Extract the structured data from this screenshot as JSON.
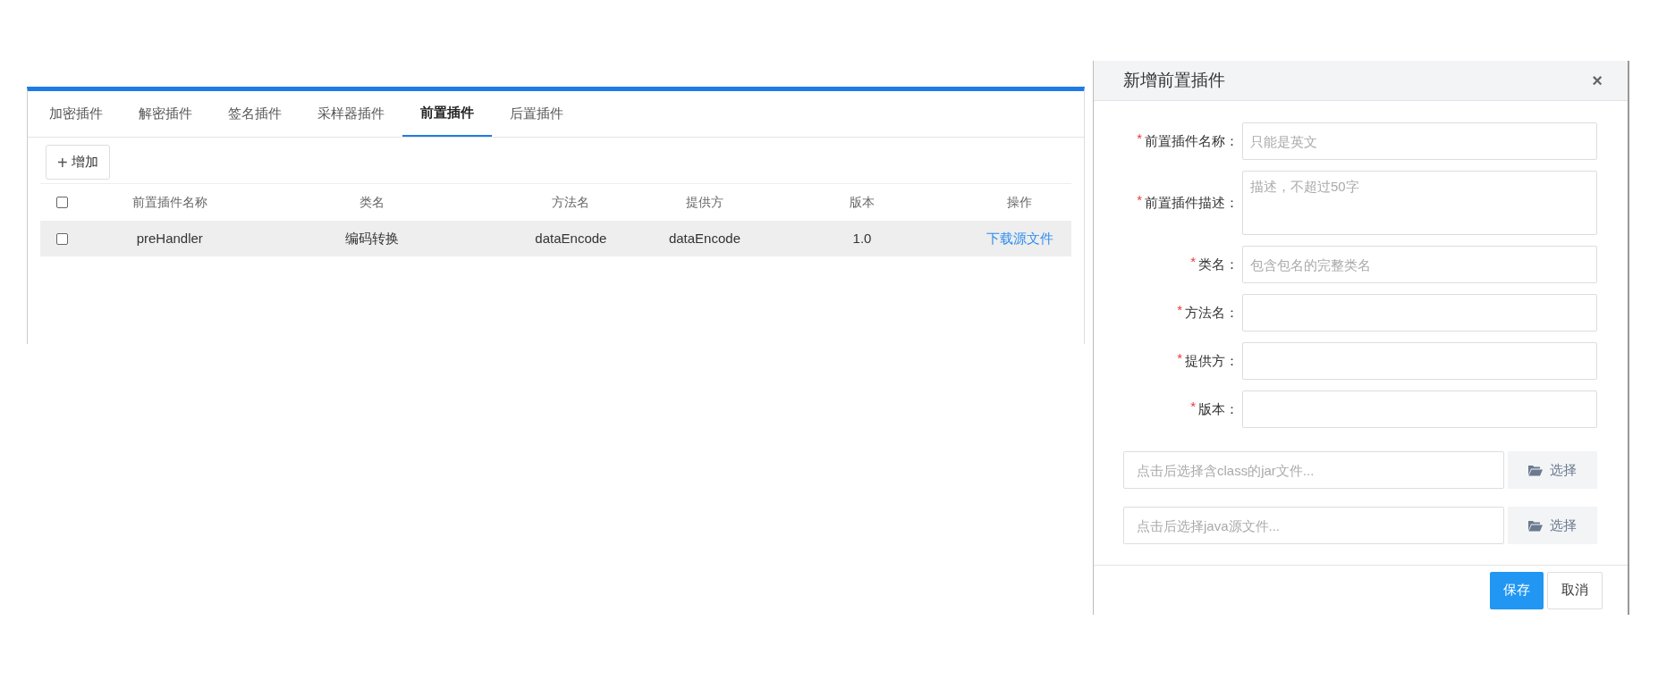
{
  "tabs": [
    {
      "label": "加密插件",
      "selected": false
    },
    {
      "label": "解密插件",
      "selected": false
    },
    {
      "label": "签名插件",
      "selected": false
    },
    {
      "label": "采样器插件",
      "selected": false
    },
    {
      "label": "前置插件",
      "selected": true
    },
    {
      "label": "后置插件",
      "selected": false
    }
  ],
  "toolbar": {
    "add_icon": "+",
    "add_label": "增加"
  },
  "table": {
    "all_checked": false,
    "columns": [
      "前置插件名称",
      "类名",
      "方法名",
      "提供方",
      "版本",
      "操作"
    ],
    "rows": [
      {
        "checked": false,
        "selected": true,
        "cells": [
          "preHandler",
          "编码转换",
          "dataEncode",
          "dataEncode",
          "1.0"
        ],
        "action": "下载源文件"
      }
    ]
  },
  "dialog": {
    "title": "新增前置插件",
    "close": "×",
    "fields": [
      {
        "kind": "input",
        "required": true,
        "label": "前置插件名称：",
        "placeholder": "只能是英文"
      },
      {
        "kind": "textarea",
        "required": true,
        "label": "前置插件描述：",
        "placeholder": "描述，不超过50字"
      },
      {
        "kind": "input",
        "required": true,
        "label": "类名：",
        "placeholder": "包含包名的完整类名"
      },
      {
        "kind": "input",
        "required": true,
        "label": "方法名："
      },
      {
        "kind": "input",
        "required": true,
        "label": "提供方："
      },
      {
        "kind": "input",
        "required": true,
        "label": "版本："
      }
    ],
    "required_mark": "*",
    "files": [
      {
        "placeholder": "点击后选择含class的jar文件...",
        "button": "选择"
      },
      {
        "placeholder": "点击后选择java源文件...",
        "button": "选择"
      }
    ],
    "buttons": [
      {
        "label": "保存",
        "primary": true
      },
      {
        "label": "取消",
        "primary": false
      }
    ]
  }
}
